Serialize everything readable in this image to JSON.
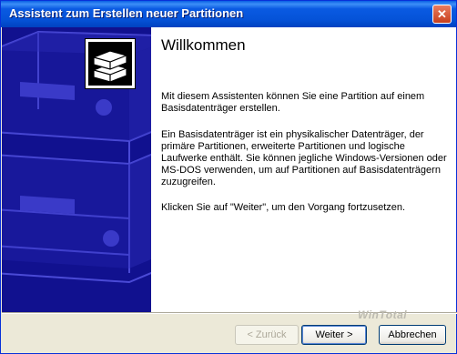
{
  "window": {
    "title": "Assistent zum Erstellen neuer Partitionen",
    "close_symbol": "✕"
  },
  "content": {
    "heading": "Willkommen",
    "paragraph1": "Mit diesem Assistenten können Sie eine Partition auf einem Basisdatenträger erstellen.",
    "paragraph2": "Ein Basisdatenträger ist ein physikalischer Datenträger, der primäre Partitionen, erweiterte Partitionen und logische Laufwerke enthält. Sie können jegliche Windows-Versionen oder MS-DOS verwenden, um auf Partitionen auf Basisdatenträgern zuzugreifen.",
    "paragraph3": "Klicken Sie auf \"Weiter\", um den Vorgang fortzusetzen."
  },
  "buttons": {
    "back": "< Zurück",
    "next": "Weiter >",
    "cancel": "Abbrechen"
  },
  "watermark": "WinTotal",
  "icons": {
    "sidebar": "disk-drive-illustration",
    "logo": "stacked-disks-icon"
  },
  "colors": {
    "sidebar": "#11118f",
    "titlebar": "#0553d8"
  }
}
